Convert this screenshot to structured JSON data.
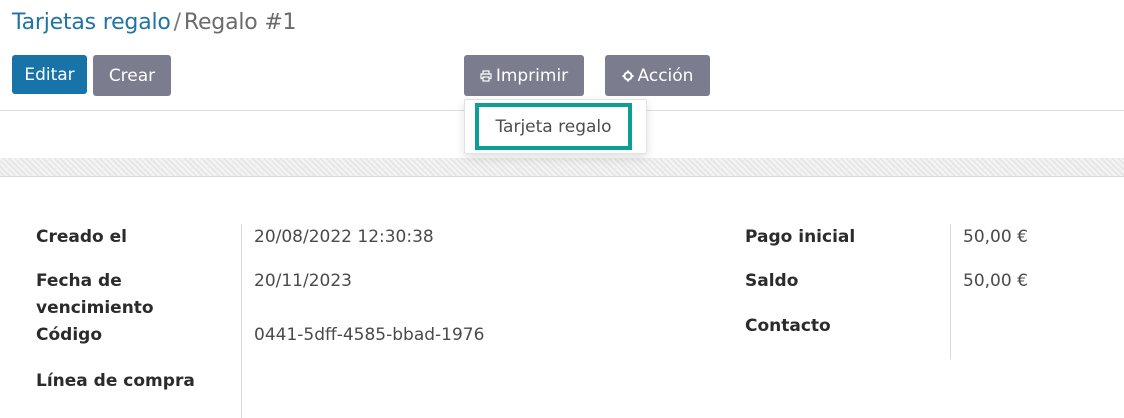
{
  "breadcrumb": {
    "parent": "Tarjetas regalo",
    "separator": "/",
    "current": "Regalo #1"
  },
  "toolbar": {
    "edit_label": "Editar",
    "create_label": "Crear",
    "print_label": "Imprimir",
    "print_icon": "print-icon",
    "action_label": "Acción",
    "action_icon": "gear-icon"
  },
  "print_menu": {
    "items": [
      {
        "label": "Tarjeta regalo"
      }
    ]
  },
  "form": {
    "left": [
      {
        "label": "Creado el",
        "value": "20/08/2022 12:30:38"
      },
      {
        "label": "Fecha de vencimiento",
        "value": "20/11/2023"
      },
      {
        "label": "Código",
        "value": "0441-5dff-4585-bbad-1976"
      },
      {
        "label": "Línea de compra",
        "value": ""
      }
    ],
    "right": [
      {
        "label": "Pago inicial",
        "value": "50,00 €"
      },
      {
        "label": "Saldo",
        "value": "50,00 €"
      },
      {
        "label": "Contacto",
        "value": ""
      }
    ]
  },
  "colors": {
    "primary": "#1773a8",
    "secondary": "#7b7c8d",
    "highlight": "#0d9e96",
    "link": "#1f73a7"
  }
}
